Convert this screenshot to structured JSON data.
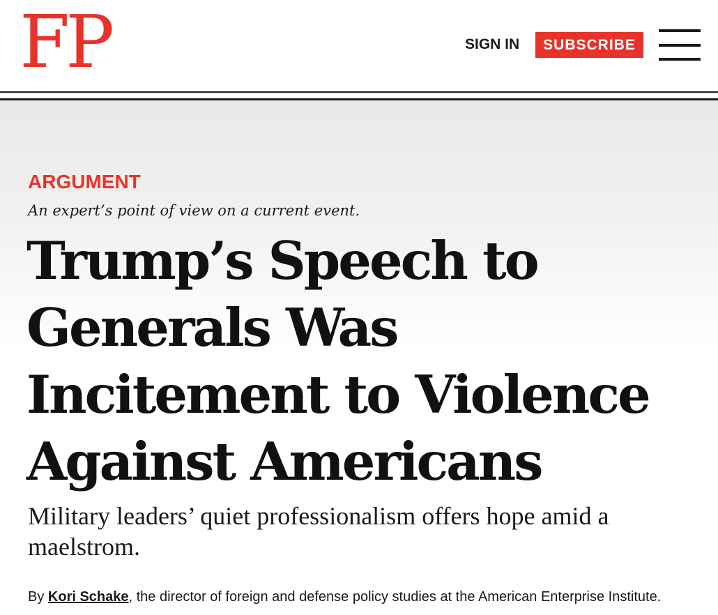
{
  "header": {
    "logo_text": "FP",
    "sign_in_label": "SIGN IN",
    "subscribe_label": "SUBSCRIBE",
    "menu_icon": "hamburger-menu-icon"
  },
  "article": {
    "kicker": "ARGUMENT",
    "kicker_description": "An expert’s point of view on a current event.",
    "headline": "Trump’s Speech to Generals Was Incitement to Violence Against Americans",
    "dek": "Military leaders’ quiet professionalism offers hope amid a maelstrom.",
    "byline": {
      "prefix": "By ",
      "author": "Kori Schake",
      "suffix": ", the director of foreign and defense policy studies at the American Enterprise Institute."
    }
  },
  "colors": {
    "brand_red": "#e8332a",
    "text": "#111111"
  }
}
